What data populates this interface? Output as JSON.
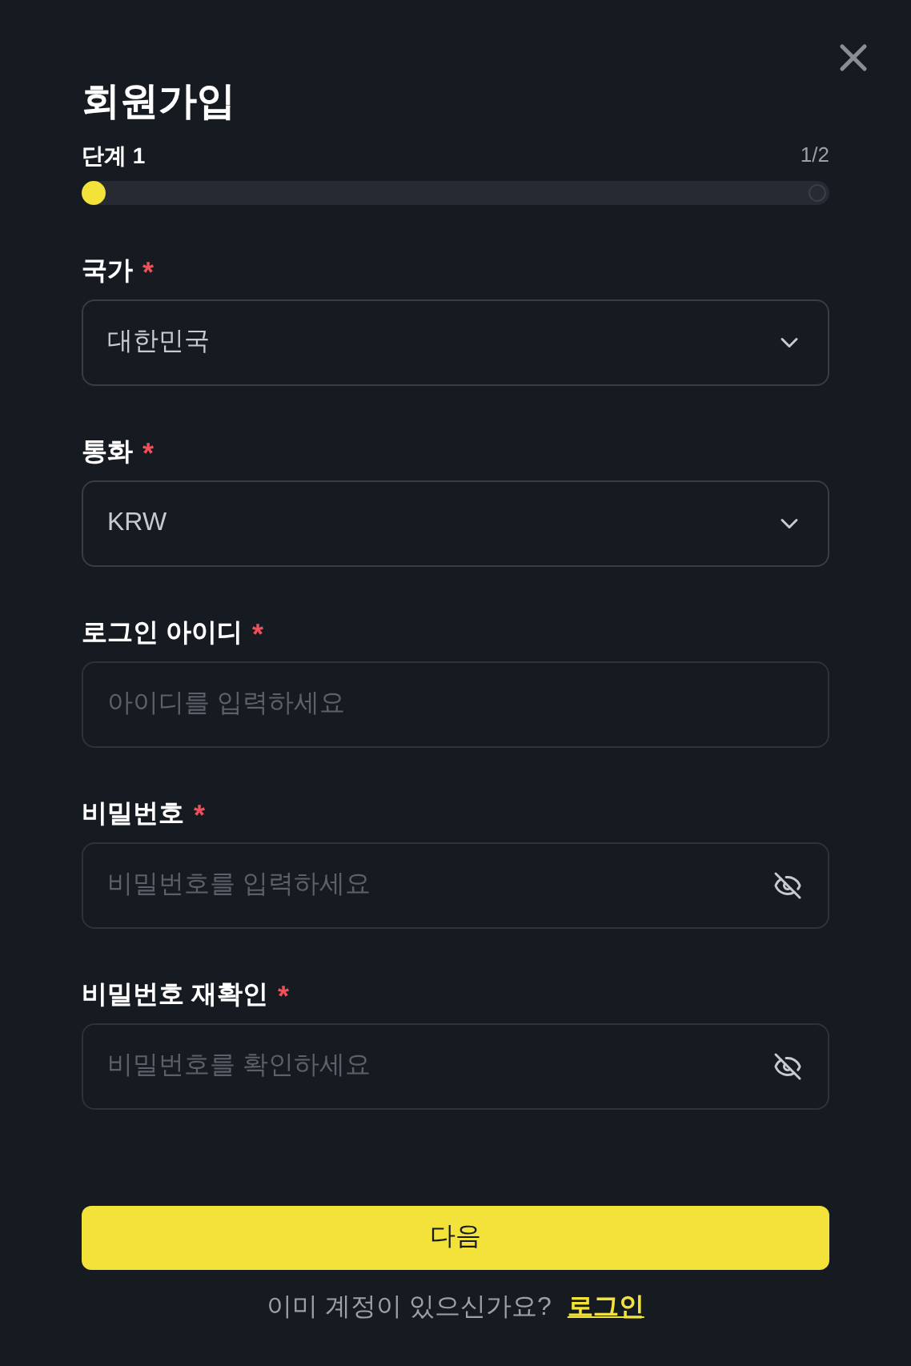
{
  "title": "회원가입",
  "step": {
    "label": "단계 1",
    "count": "1/2",
    "steps": [
      {
        "reached": true
      },
      {
        "reached": false
      }
    ]
  },
  "fields": [
    {
      "kind": "select",
      "label": "국가",
      "required": true,
      "value": "대한민국"
    },
    {
      "kind": "select",
      "label": "통화",
      "required": true,
      "value": "KRW"
    },
    {
      "kind": "text",
      "label": "로그인 아이디",
      "required": true,
      "placeholder": "아이디를 입력하세요"
    },
    {
      "kind": "password",
      "label": "비밀번호",
      "required": true,
      "placeholder": "비밀번호를 입력하세요"
    },
    {
      "kind": "password",
      "label": "비밀번호 재확인",
      "required": true,
      "placeholder": "비밀번호를 확인하세요"
    }
  ],
  "required_mark": "*",
  "submit": "다음",
  "footer": {
    "text": "이미 계정이 있으신가요?",
    "link": "로그인"
  }
}
